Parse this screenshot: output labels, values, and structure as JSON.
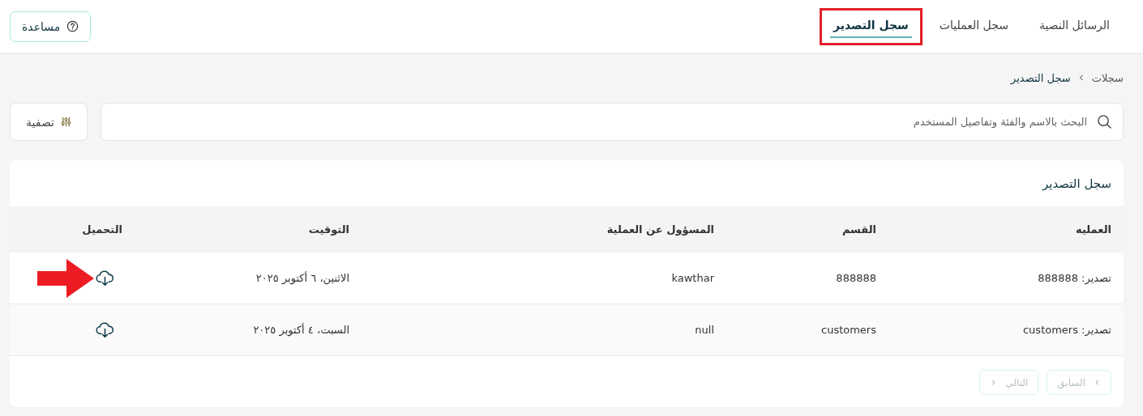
{
  "tabs": [
    {
      "label": "الرسائل النصية",
      "selected": false,
      "highlighted": false
    },
    {
      "label": "سجل العمليات",
      "selected": false,
      "highlighted": false
    },
    {
      "label": "سجل التصدير",
      "selected": true,
      "highlighted": true
    }
  ],
  "help_button": "مساعدة",
  "breadcrumb": [
    "سجلات",
    "سجل التصدير"
  ],
  "search": {
    "placeholder": "البحث بالاسم والفئة وتفاصيل المستخدم"
  },
  "filter_button": "تصفية",
  "card": {
    "title": "سجل التصدير",
    "table": {
      "columns": [
        "العمليه",
        "القسم",
        "المسؤول عن العملية",
        "التوقيت",
        "التحميل"
      ],
      "rows": [
        {
          "operation": "تصدير: 888888",
          "section": "888888",
          "owner": "kawthar",
          "time": "الاثنين، ٦ أكتوبر ٢٠٢٥",
          "pointed": true
        },
        {
          "operation": "تصدير: customers",
          "section": "customers",
          "owner": "null",
          "time": "السبت، ٤ أكتوبر ٢٠٢٥",
          "pointed": false
        }
      ]
    },
    "pagination": [
      {
        "kind": "previous",
        "label": "السابق",
        "disabled": true
      },
      {
        "kind": "next",
        "label": "التالي",
        "disabled": true
      }
    ]
  }
}
